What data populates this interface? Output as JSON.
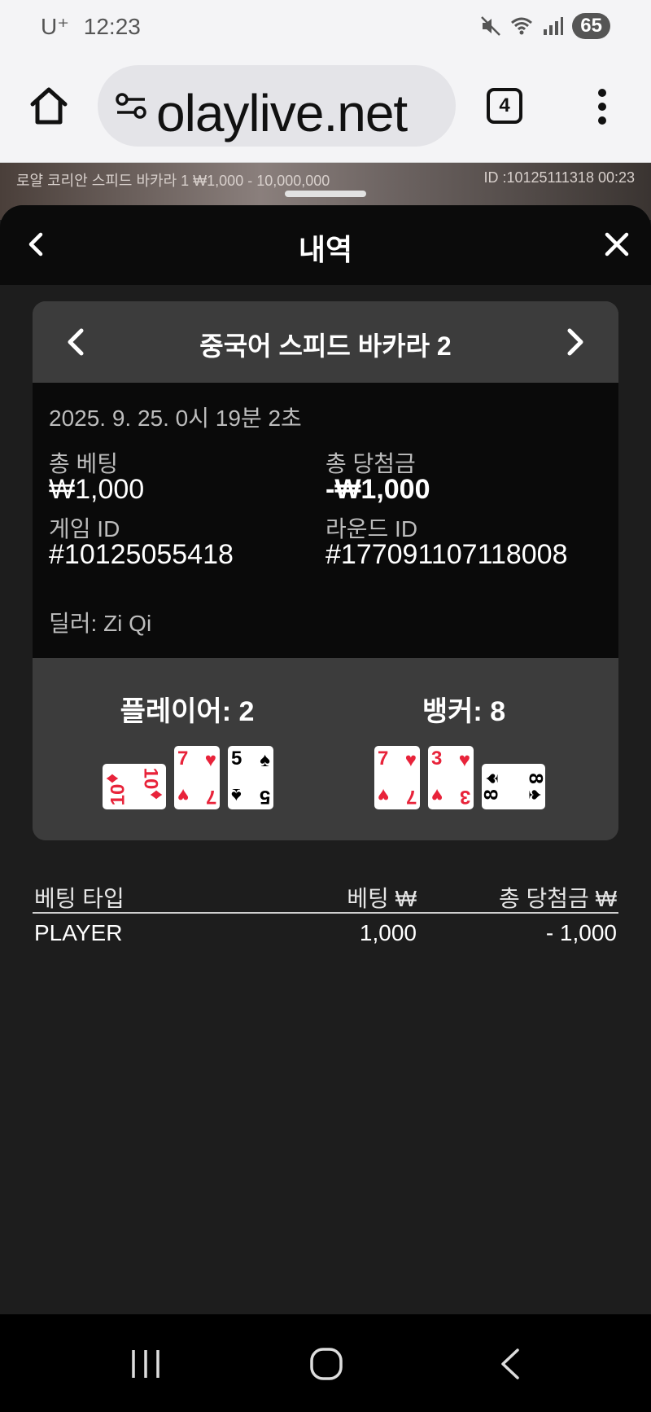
{
  "status_bar": {
    "carrier": "U⁺",
    "time": "12:23",
    "battery": "65"
  },
  "browser": {
    "url_text": "olaylive.net",
    "tab_count": "4"
  },
  "background_game": {
    "left_info": "로얄 코리안 스피드 바카라 1 ₩1,000 - 10,000,000",
    "right_info": "ID :10125111318 00:23"
  },
  "sheet": {
    "title": "내역"
  },
  "record": {
    "game_title": "중국어 스피드 바카라 2",
    "datetime": "2025. 9. 25. 0시 19분 2초",
    "total_bet_label": "총 베팅",
    "total_bet_value": "₩1,000",
    "total_win_label": "총 당첨금",
    "total_win_value": "-₩1,000",
    "game_id_label": "게임 ID",
    "game_id_value": "#10125055418",
    "round_id_label": "라운드 ID",
    "round_id_value": "#177091107118008",
    "dealer": "딜러: Zi Qi"
  },
  "hands": {
    "player_label": "플레이어: 2",
    "banker_label": "뱅커: 8",
    "player_cards": [
      {
        "rank": "10",
        "suit": "♦",
        "color": "red",
        "rotated": true
      },
      {
        "rank": "7",
        "suit": "♥",
        "color": "red",
        "rotated": false
      },
      {
        "rank": "5",
        "suit": "♠",
        "color": "black",
        "rotated": false
      }
    ],
    "banker_cards": [
      {
        "rank": "7",
        "suit": "♥",
        "color": "red",
        "rotated": false
      },
      {
        "rank": "3",
        "suit": "♥",
        "color": "red",
        "rotated": false
      },
      {
        "rank": "8",
        "suit": "♠",
        "color": "black",
        "rotated": true
      }
    ]
  },
  "bet_table": {
    "headers": [
      "베팅 타입",
      "베팅 ₩",
      "총 당첨금 ₩"
    ],
    "rows": [
      {
        "type": "PLAYER",
        "bet": "1,000",
        "win": "- 1,000"
      }
    ]
  },
  "colors": {
    "background": "#1d1d1d",
    "card_panel": "#3c3c3c",
    "info_panel": "#0a0a0a",
    "suit_red": "#e8233a"
  }
}
